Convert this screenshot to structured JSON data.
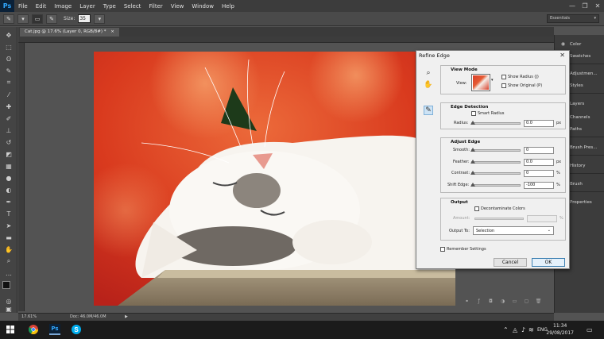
{
  "app": {
    "logo": "Ps"
  },
  "menu": [
    "File",
    "Edit",
    "Image",
    "Layer",
    "Type",
    "Select",
    "Filter",
    "View",
    "Window",
    "Help"
  ],
  "window_controls": {
    "minimize": "—",
    "restore": "❐",
    "close": "✕"
  },
  "options_bar": {
    "size_label": "Size:",
    "size_value": "35",
    "workspace": "Essentials"
  },
  "document": {
    "tab_title": "Cat.jpg @ 17.6% (Layer 0, RGB/8#) *"
  },
  "status": {
    "zoom": "17.61%",
    "doc_size": "Doc: 46.0M/46.0M",
    "arrow": "▶"
  },
  "panels": [
    {
      "label": "Color",
      "icon": "color-icon"
    },
    {
      "label": "Swatches",
      "icon": "swatches-icon"
    },
    {
      "label": "Adjustmen...",
      "icon": "adjustments-icon"
    },
    {
      "label": "Styles",
      "icon": "styles-icon"
    },
    {
      "label": "Layers",
      "icon": "layers-icon"
    },
    {
      "label": "Channels",
      "icon": "channels-icon"
    },
    {
      "label": "Paths",
      "icon": "paths-icon"
    },
    {
      "label": "Brush Pres...",
      "icon": "brush-presets-icon"
    },
    {
      "label": "History",
      "icon": "history-icon"
    },
    {
      "label": "Brush",
      "icon": "brush-icon"
    },
    {
      "label": "Properties",
      "icon": "properties-icon"
    }
  ],
  "refine_edge": {
    "title": "Refine Edge",
    "view_mode": {
      "title": "View Mode",
      "view_label": "View:",
      "show_radius": "Show Radius (J)",
      "show_original": "Show Original (P)"
    },
    "edge_detection": {
      "title": "Edge Detection",
      "smart_radius": "Smart Radius",
      "radius_label": "Radius:",
      "radius_value": "0.0",
      "radius_unit": "px"
    },
    "adjust_edge": {
      "title": "Adjust Edge",
      "smooth_label": "Smooth:",
      "smooth_value": "0",
      "feather_label": "Feather:",
      "feather_value": "0.0",
      "feather_unit": "px",
      "contrast_label": "Contrast:",
      "contrast_value": "0",
      "contrast_unit": "%",
      "shift_label": "Shift Edge:",
      "shift_value": "-100",
      "shift_unit": "%"
    },
    "output": {
      "title": "Output",
      "decontaminate": "Decontaminate Colors",
      "amount_label": "Amount:",
      "amount_unit": "%",
      "output_to_label": "Output To:",
      "output_to_value": "Selection"
    },
    "remember": "Remember Settings",
    "cancel": "Cancel",
    "ok": "OK"
  },
  "taskbar": {
    "lang": "ENG",
    "time": "11:34",
    "date": "29/08/2017"
  }
}
